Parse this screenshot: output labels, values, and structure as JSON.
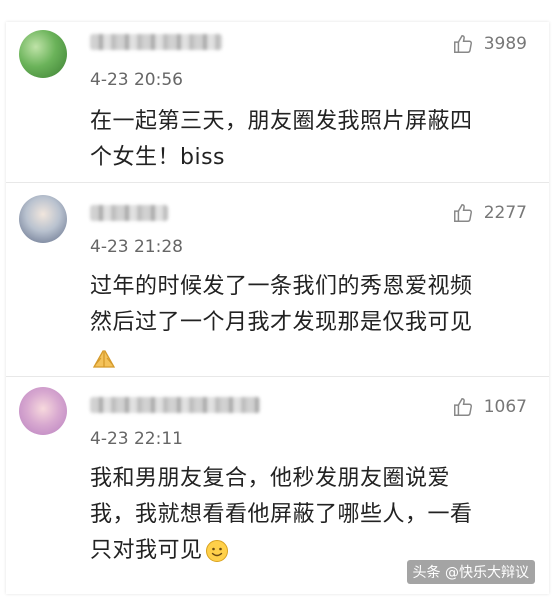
{
  "comments": [
    {
      "likes": "3989",
      "time": "4-23 20:56",
      "text_lines": [
        "在一起第三天，朋友圈发我照片屏蔽四",
        "个女生！biss"
      ],
      "avatar_icon": "green-avatar"
    },
    {
      "likes": "2277",
      "time": "4-23 21:28",
      "text_lines": [
        "过年的时候发了一条我们的秀恩爱视频",
        "然后过了一个月我才发现那是仅我可见"
      ],
      "trailing_icon": "clasped-hands-emoji"
    },
    {
      "likes": "1067",
      "time": "4-23 22:11",
      "text_lines": [
        "我和男朋友复合，他秒发朋友圈说爱",
        "我，我就想看看他屏蔽了哪些人，一看",
        "只对我可见"
      ],
      "trailing_icon": "smile-emoji"
    }
  ],
  "watermark": "头条 @快乐大辩议",
  "colors": {
    "like_gray": "#777777",
    "text": "#222222"
  }
}
